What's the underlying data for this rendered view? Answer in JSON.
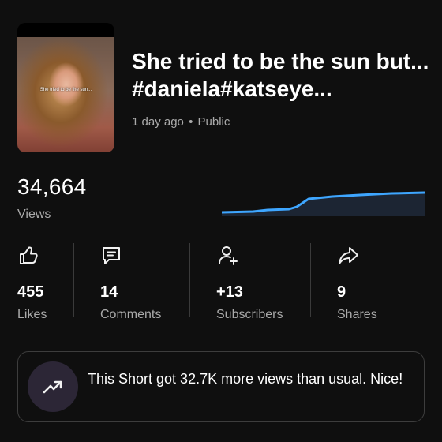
{
  "video": {
    "thumbnail_caption": "She tried to be the sun...",
    "title": "She tried to be the sun but... #daniela#katseye...",
    "age": "1 day ago",
    "separator": "•",
    "visibility": "Public"
  },
  "views": {
    "count": "34,664",
    "label": "Views",
    "trend_color": "#3ea6ff"
  },
  "stats": [
    {
      "icon": "thumbs-up-icon",
      "value": "455",
      "label": "Likes"
    },
    {
      "icon": "comment-icon",
      "value": "14",
      "label": "Comments"
    },
    {
      "icon": "add-subscriber-icon",
      "value": "+13",
      "label": "Subscribers"
    },
    {
      "icon": "share-icon",
      "value": "9",
      "label": "Shares"
    }
  ],
  "insight": {
    "icon": "trending-up-icon",
    "text": "This Short got 32.7K more views than usual. Nice!"
  }
}
